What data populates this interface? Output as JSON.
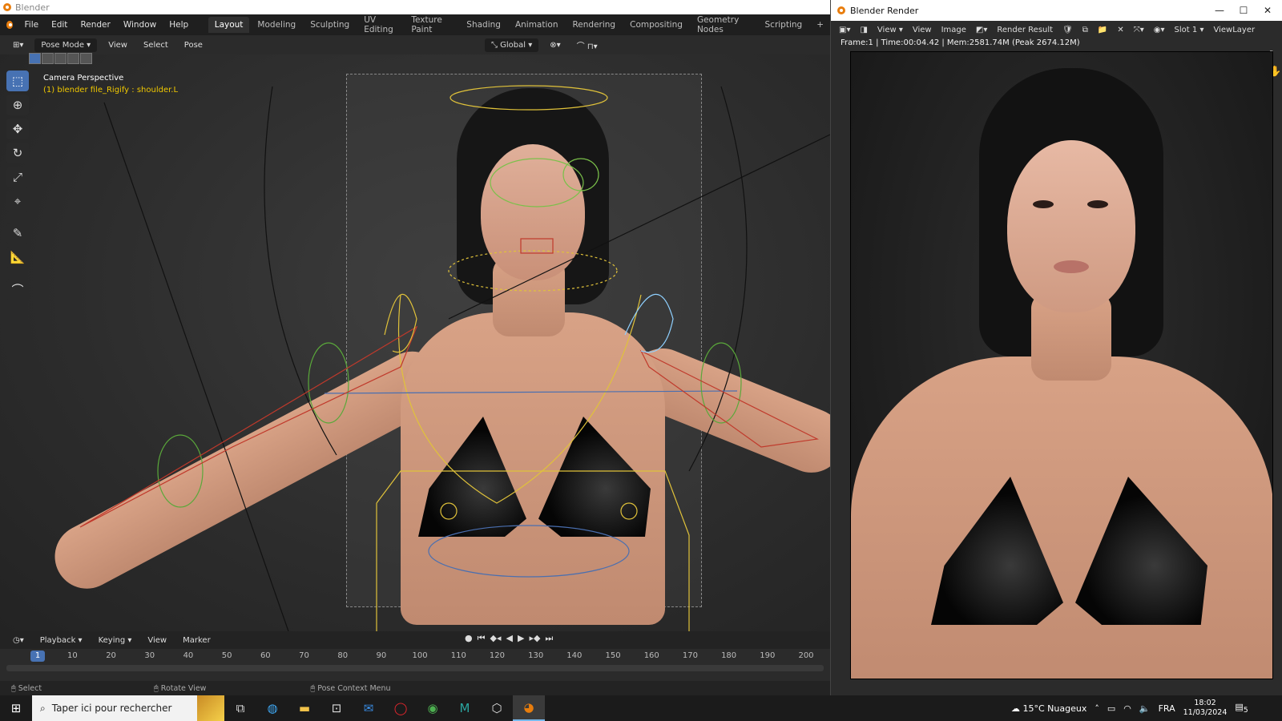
{
  "main_window": {
    "title": "Blender",
    "menus": [
      "File",
      "Edit",
      "Render",
      "Window",
      "Help"
    ],
    "workspaces": [
      "Layout",
      "Modeling",
      "Sculpting",
      "UV Editing",
      "Texture Paint",
      "Shading",
      "Animation",
      "Rendering",
      "Compositing",
      "Geometry Nodes",
      "Scripting",
      "+"
    ],
    "active_workspace": "Layout"
  },
  "viewport_header": {
    "mode": "Pose Mode",
    "menus": [
      "View",
      "Select",
      "Pose"
    ],
    "orientation": "Global"
  },
  "viewport": {
    "camera_title": "Camera Perspective",
    "active_object": "(1) blender file_Rigify : shoulder.L"
  },
  "toolbar": {
    "tools": [
      {
        "icon": "select-box-icon",
        "glyph": "⬚",
        "active": true
      },
      {
        "icon": "cursor-icon",
        "glyph": "⊕",
        "active": false
      },
      {
        "icon": "move-icon",
        "glyph": "✥",
        "active": false
      },
      {
        "icon": "rotate-icon",
        "glyph": "↻",
        "active": false
      },
      {
        "icon": "scale-icon",
        "glyph": "⤢",
        "active": false
      },
      {
        "icon": "transform-icon",
        "glyph": "⌖",
        "active": false
      },
      {
        "icon": "annotate-icon",
        "glyph": "✎",
        "active": false
      },
      {
        "icon": "measure-icon",
        "glyph": "📐",
        "active": false
      },
      {
        "icon": "relax-icon",
        "glyph": "⌒",
        "active": false
      }
    ]
  },
  "timeline": {
    "menus": [
      "Playback",
      "Keying",
      "View",
      "Marker"
    ],
    "current_frame": "1",
    "ticks": [
      "10",
      "20",
      "30",
      "40",
      "50",
      "60",
      "70",
      "80",
      "90",
      "100",
      "110",
      "120",
      "130",
      "140",
      "150",
      "160",
      "170",
      "180",
      "190",
      "200"
    ]
  },
  "statusbar": {
    "items": [
      "Select",
      "Rotate View",
      "Pose Context Menu"
    ]
  },
  "render_window": {
    "title": "Blender Render",
    "menus": [
      "View",
      "View",
      "Image"
    ],
    "image_name": "Render Result",
    "slot": "Slot 1",
    "view_layer": "ViewLayer",
    "stats": "Frame:1 | Time:00:04.42 | Mem:2581.74M (Peak 2674.12M)"
  },
  "taskbar": {
    "search_placeholder": "Taper ici pour rechercher",
    "weather": "15°C  Nuageux",
    "language": "FRA",
    "time": "18:02",
    "date": "11/03/2024",
    "notifications": "5"
  },
  "colors": {
    "accent": "#4772b3",
    "bone_yellow": "#e0c23a",
    "bone_green": "#7ac04a",
    "bone_red": "#c0392b",
    "bone_blue": "#8fd0ff"
  }
}
